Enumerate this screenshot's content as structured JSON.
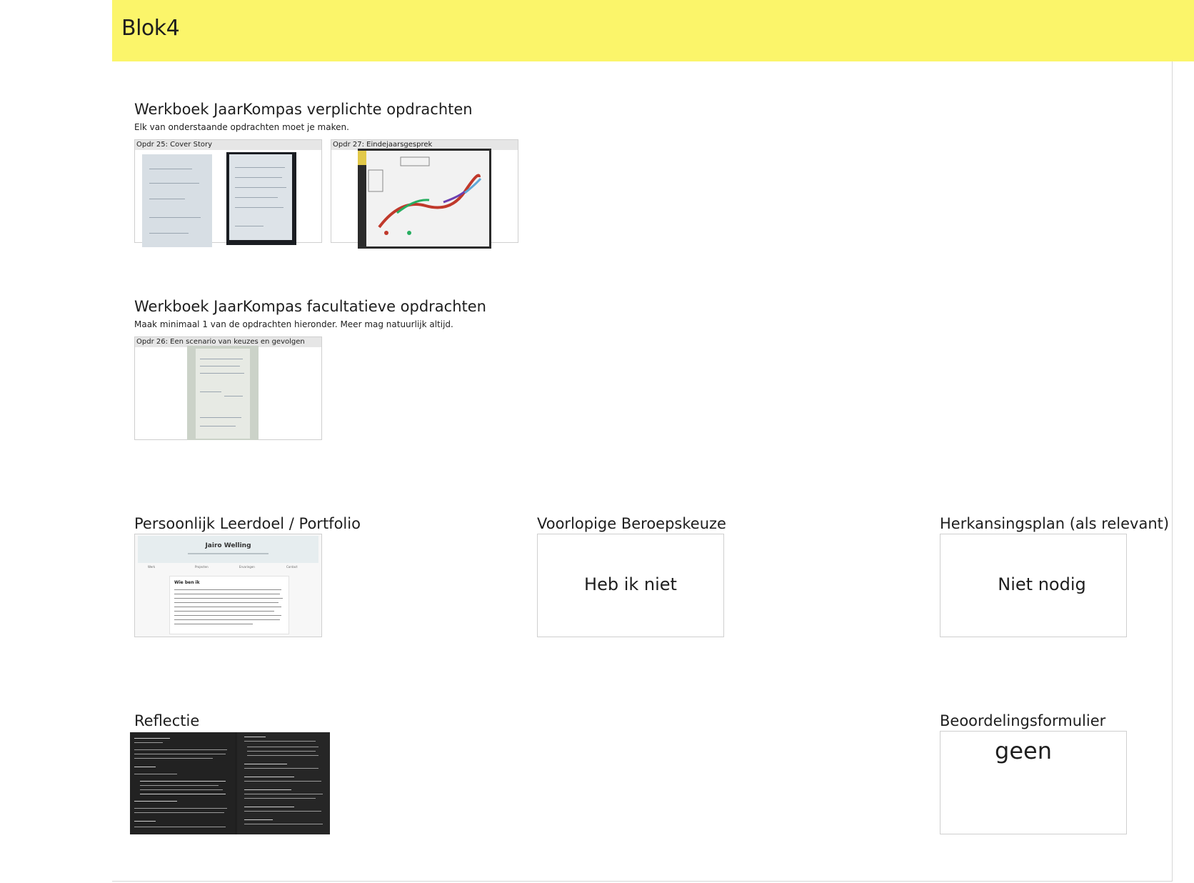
{
  "header": {
    "title": "Blok4",
    "color": "#fbf56a"
  },
  "verplicht": {
    "title": "Werkboek JaarKompas verplichte opdrachten",
    "subtitle": "Elk van onderstaande opdrachten moet je maken.",
    "cards": [
      {
        "label": "Opdr 25: Cover Story"
      },
      {
        "label": "Opdr 27: Eindejaarsgesprek"
      }
    ]
  },
  "facultatief": {
    "title": "Werkboek JaarKompas facultatieve opdrachten",
    "subtitle": "Maak minimaal 1 van de opdrachten hieronder. Meer mag natuurlijk altijd.",
    "cards": [
      {
        "label": "Opdr 26: Een scenario van keuzes en gevolgen"
      }
    ]
  },
  "leerdoel": {
    "title": "Persoonlijk Leerdoel / Portfolio",
    "portfolio_name": "Jairo Welling",
    "portfolio_nav": [
      "Werk",
      "Projecten",
      "Ervaringen",
      "Contact"
    ],
    "portfolio_heading": "Wie ben ik"
  },
  "beroepskeuze": {
    "title": "Voorlopige Beroepskeuze",
    "value": "Heb ik niet"
  },
  "herkansing": {
    "title": "Herkansingsplan (als relevant)",
    "value": "Niet nodig"
  },
  "reflectie": {
    "title": "Reflectie"
  },
  "beoordeling": {
    "title": "Beoordelingsformulier",
    "value": "geen"
  }
}
